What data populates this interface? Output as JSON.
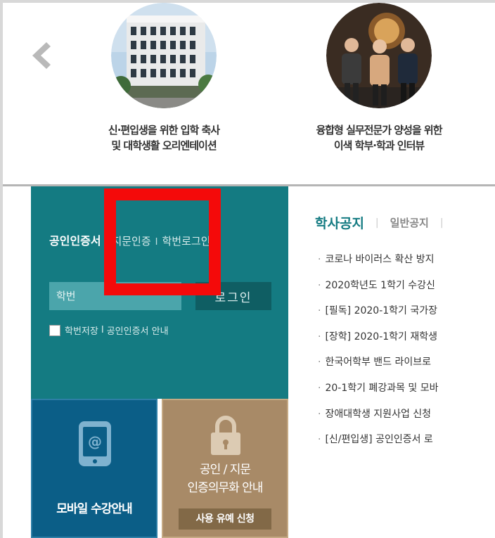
{
  "carousel": {
    "slides": [
      {
        "caption_line1": "신·편입생을 위한 입학 축사",
        "caption_line2": "및 대학생활 오리엔테이션",
        "image": "campus-building-photo"
      },
      {
        "caption_line1": "융합형 실무전문가 양성을 위한",
        "caption_line2": "이색 학부·학과 인터뷰",
        "image": "interview-people-photo"
      }
    ],
    "prev_icon": "chevron-left-icon"
  },
  "login": {
    "tabs": [
      "공인인증서",
      "지문인증",
      "학번로그인"
    ],
    "id_placeholder": "학번",
    "login_label": "로그인",
    "save_label": "학번저장",
    "cert_guide_label": "공인인증서 안내"
  },
  "tiles": {
    "mobile": {
      "label": "모바일 수강안내",
      "icon": "mobile-phone-icon"
    },
    "cert": {
      "line1": "공인 / 지문",
      "line2": "인증의무화 안내",
      "button": "사용 유예 신청",
      "icon": "lock-icon"
    }
  },
  "notices": {
    "tabs": [
      "학사공지",
      "일반공지"
    ],
    "items": [
      "코로나 바이러스 확산 방지",
      "2020학년도 1학기 수강신",
      "[필독] 2020-1학기 국가장",
      "[장학] 2020-1학기 재학생",
      "한국어학부 밴드 라이브로",
      "20-1학기 폐강과목 및 모바",
      "장애대학생 지원사업 신청",
      "[신/편입생] 공인인증서 로"
    ]
  },
  "colors": {
    "teal_panel": "#147b82",
    "mobile_tile": "#0b5e87",
    "cert_tile": "#a88a67",
    "highlight": "#f40a0a"
  }
}
